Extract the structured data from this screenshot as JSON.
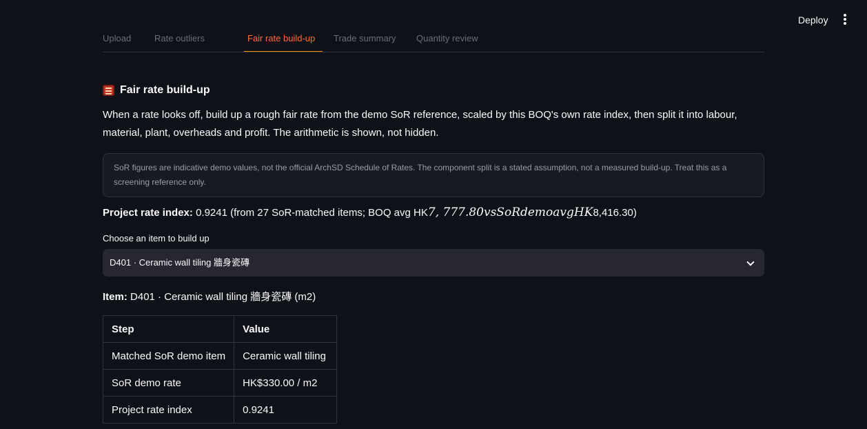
{
  "header": {
    "deploy_label": "Deploy",
    "menu_icon": "kebab-menu-icon"
  },
  "tabs": [
    {
      "label": "Upload"
    },
    {
      "label": "Rate outliers"
    },
    {
      "label": "Fair rate build-up"
    },
    {
      "label": "Trade summary"
    },
    {
      "label": "Quantity review"
    }
  ],
  "section": {
    "icon": "abacus-icon",
    "title": "Fair rate build-up",
    "description": "When a rate looks off, build up a rough fair rate from the demo SoR reference, scaled by this BOQ's own rate index, then split it into labour, material, plant, overheads and profit. The arithmetic is shown, not hidden.",
    "notice": "SoR figures are indicative demo values, not the official ArchSD Schedule of Rates. The component split is a stated assumption, not a measured build-up. Treat this as a screening reference only."
  },
  "rate_index": {
    "label": "Project rate index:",
    "value_prefix": "0.9241 (from 27 SoR-matched items; BOQ avg HK",
    "math_text": "7, 777.80vsSoRdemoavgHK",
    "value_suffix": "8,416.30)"
  },
  "picker": {
    "label": "Choose an item to build up",
    "selected": "D401 · Ceramic wall tiling 牆身瓷磚"
  },
  "item": {
    "label": "Item:",
    "value": "D401 · Ceramic wall tiling 牆身瓷磚 (m2)"
  },
  "table": {
    "headers": [
      "Step",
      "Value"
    ],
    "rows": [
      [
        "Matched SoR demo item",
        "Ceramic wall tiling"
      ],
      [
        "SoR demo rate",
        "HK$330.00 / m2"
      ],
      [
        "Project rate index",
        "0.9241"
      ]
    ]
  }
}
